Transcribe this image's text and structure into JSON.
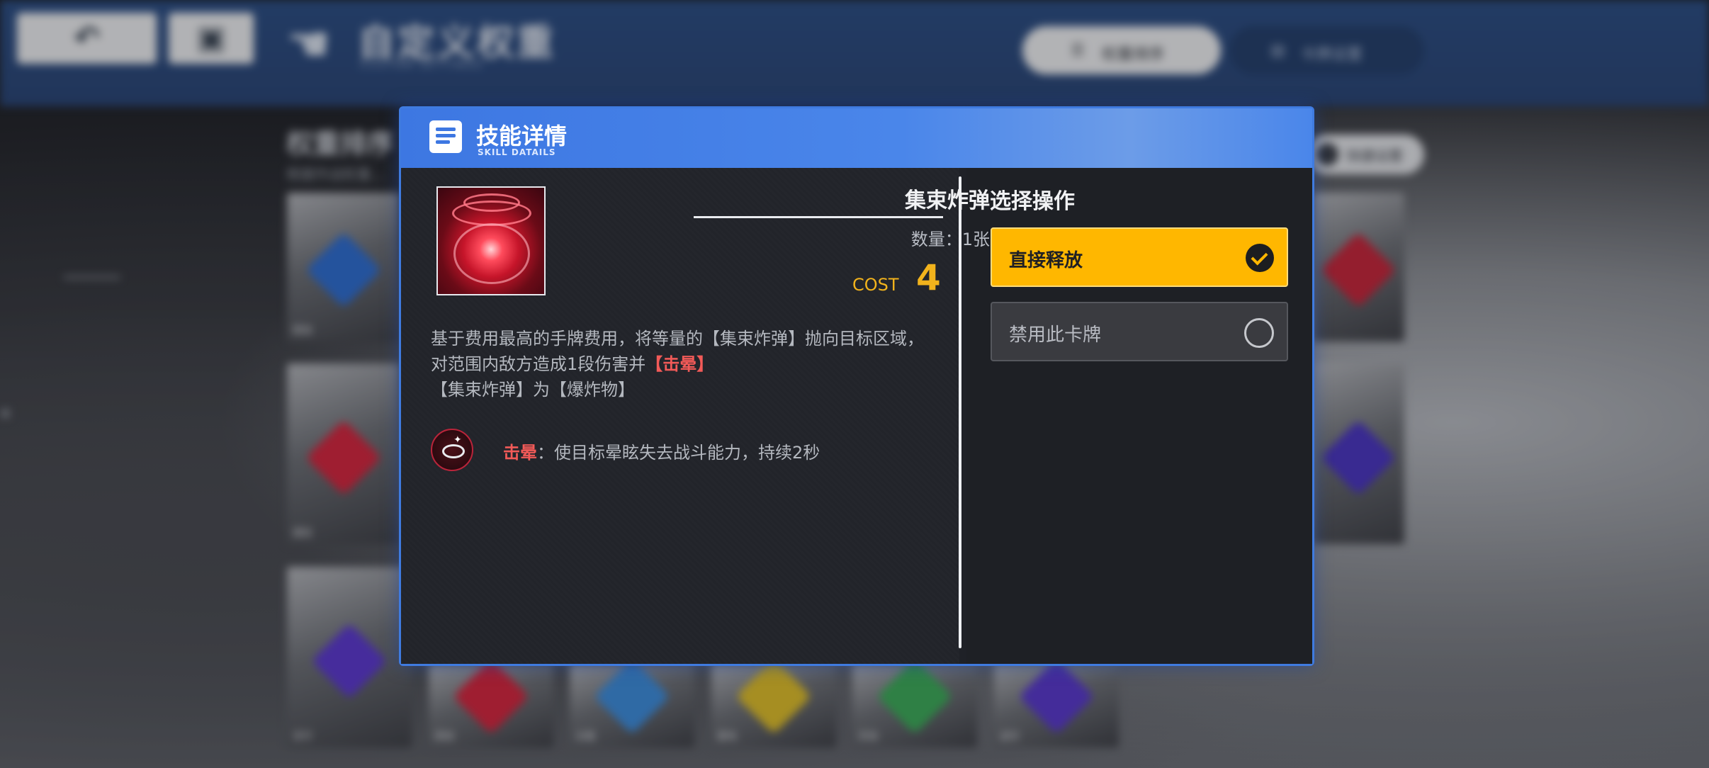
{
  "header": {
    "back_icon": "undo-icon",
    "save_icon": "save-icon",
    "title": "自定义权重",
    "subtitle": "CUSTOM SETTINGS",
    "tabs": [
      {
        "label": "权重排序",
        "icon": "list-icon",
        "active": true
      },
      {
        "label": "卡牌设置",
        "icon": "card-icon",
        "active": false
      }
    ]
  },
  "background": {
    "section_title": "权重排序",
    "section_sub": "根据作战权重...",
    "quick_button": "快捷设置",
    "cards_bottom": [
      {
        "tag": "赤炎",
        "gem": "#6b3fd6"
      },
      {
        "tag": "燃烧",
        "gem": "#d8263f"
      },
      {
        "tag": "冰霜",
        "gem": "#3e8fe0"
      },
      {
        "tag": "雷电",
        "gem": "#e2c12a"
      },
      {
        "tag": "风蚀",
        "gem": "#3dae5a"
      },
      {
        "tag": "虚空",
        "gem": "#5a3ad0"
      }
    ],
    "cards_left": [
      {
        "tag": "精准",
        "gem": "#2f6fd4"
      },
      {
        "tag": "爆发",
        "gem": "#d8263f"
      },
      {
        "tag": "坚守",
        "gem": "#5d3ad3"
      }
    ],
    "cards_right": [
      {
        "tag": "",
        "gem": "#c9263b"
      },
      {
        "tag": "",
        "gem": "#4b36c4"
      }
    ]
  },
  "modal": {
    "title": "技能详情",
    "title_en": "SKILL DATAILS",
    "skill": {
      "name": "集束炸弹",
      "quantity": "数量：1张",
      "cost_label": "COST",
      "cost_value": "4",
      "desc_line1": "基于费用最高的手牌费用，将等量的【集束炸弹】抛向目标区域，",
      "desc_line2_a": "对范围内敌方造成1段伤害并",
      "desc_line2_b": "【击晕】",
      "desc_line3": "【集束炸弹】为【爆炸物】",
      "status_name": "击晕",
      "status_desc": "：使目标晕眩失去战斗能力，持续2秒"
    },
    "operations": {
      "title": "选择操作",
      "options": [
        {
          "label": "直接释放",
          "selected": true
        },
        {
          "label": "禁用此卡牌",
          "selected": false
        }
      ]
    }
  }
}
